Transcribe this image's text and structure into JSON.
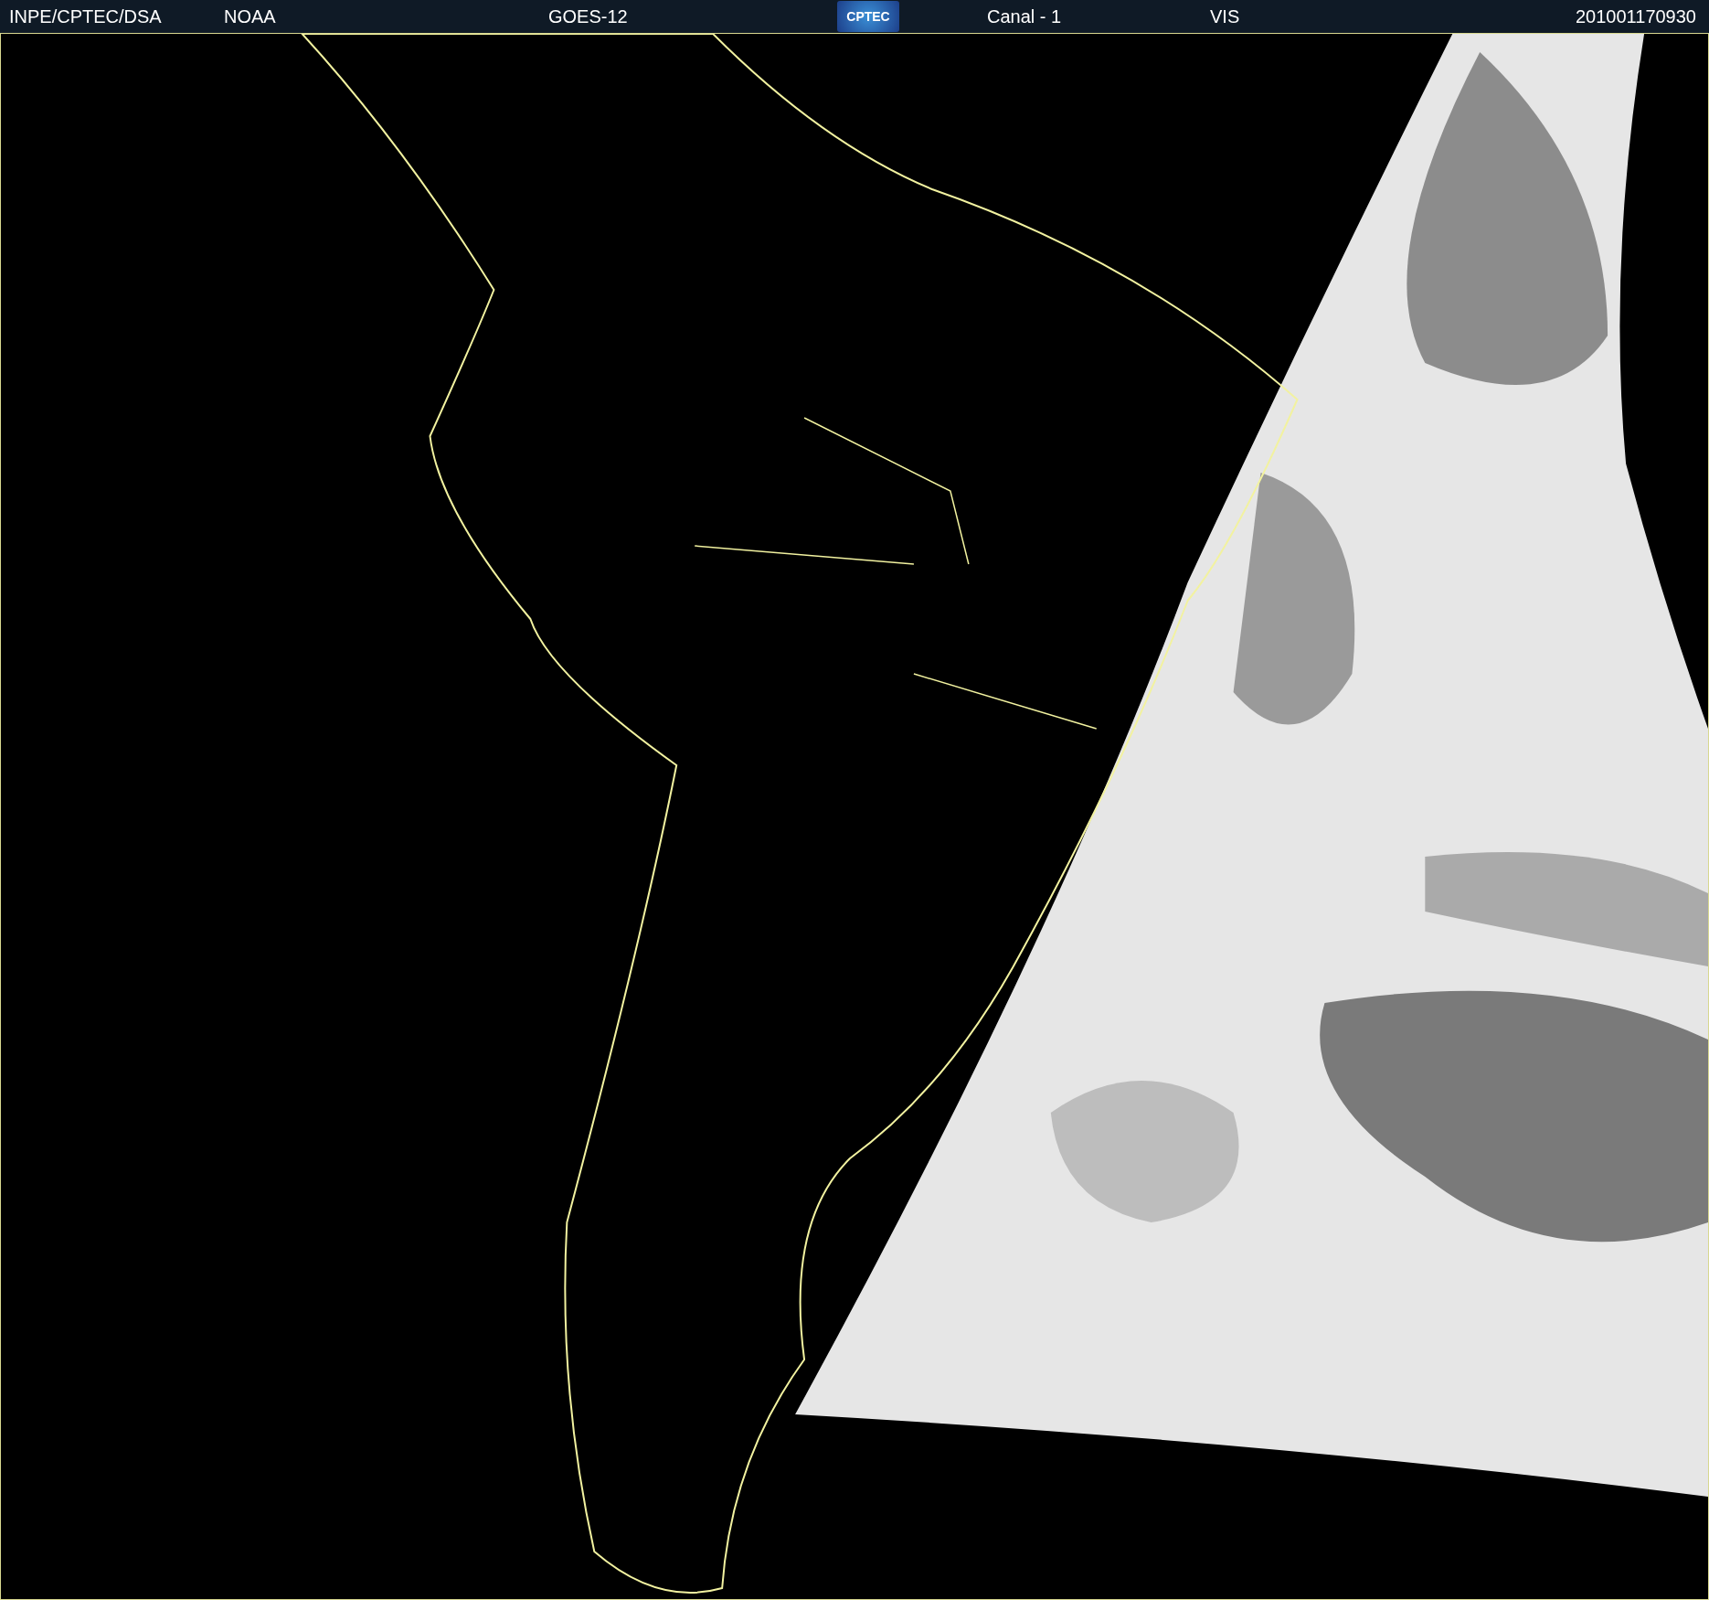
{
  "header": {
    "source": "INPE/CPTEC/DSA",
    "agency": "NOAA",
    "satellite": "GOES-12",
    "logo": "CPTEC",
    "channel": "Canal - 1",
    "band": "VIS",
    "timestamp": "201001170930"
  }
}
